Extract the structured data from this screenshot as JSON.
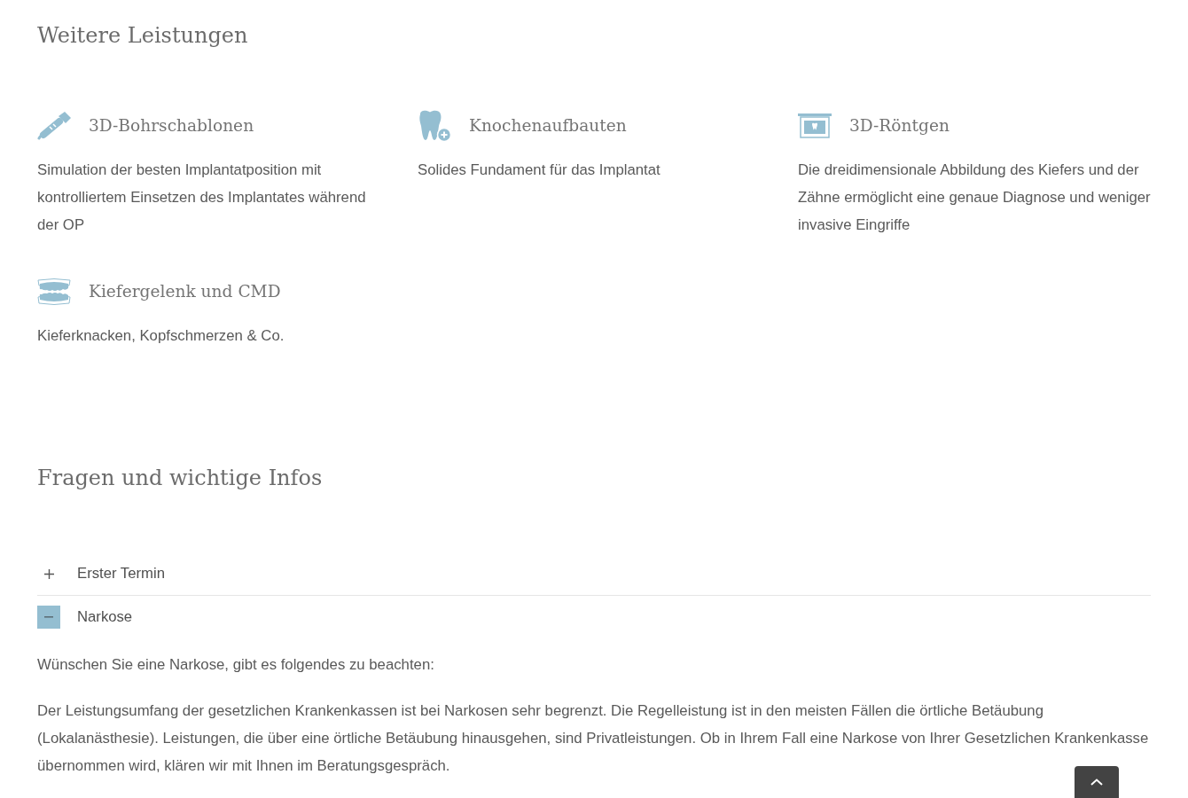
{
  "services": {
    "title": "Weitere Leistungen",
    "items": [
      {
        "kind": "handpiece",
        "title": "3D-Bohrschablonen",
        "text": "Simulation der besten Implantatposition mit kontrolliertem Einsetzen des Implantates während der OP"
      },
      {
        "kind": "tooth-plus",
        "title": "Knochenaufbauten",
        "text": "Solides Fundament für das Implantat"
      },
      {
        "kind": "xray",
        "title": "3D-Röntgen",
        "text": "Die dreidimensionale Abbildung des Kiefers und der Zähne ermöglicht eine genaue Diagnose und weniger invasive Eingriffe"
      },
      {
        "kind": "dentures",
        "title": "Kiefergelenk und CMD",
        "text": "Kieferknacken, Kopfschmerzen & Co."
      }
    ]
  },
  "faq": {
    "title": "Fragen und wichtige Infos",
    "items": [
      {
        "title": "Erster Termin",
        "expanded": false
      },
      {
        "title": "Narkose",
        "expanded": true,
        "paragraphs": [
          "Wünschen Sie eine Narkose, gibt es folgendes zu beachten:",
          "Der Leistungsumfang der gesetzlichen Krankenkassen ist bei Narkosen sehr begrenzt. Die Regelleistung ist in den meisten Fällen die örtliche Betäubung (Lokalanästhesie). Leistungen, die über eine örtliche Betäubung hinausgehen, sind Privatleistungen. Ob in Ihrem Fall eine Narkose von Ihrer Gesetzlichen Krankenkasse übernommen wird, klären wir mit Ihnen im Beratungsgespräch."
        ]
      }
    ]
  }
}
